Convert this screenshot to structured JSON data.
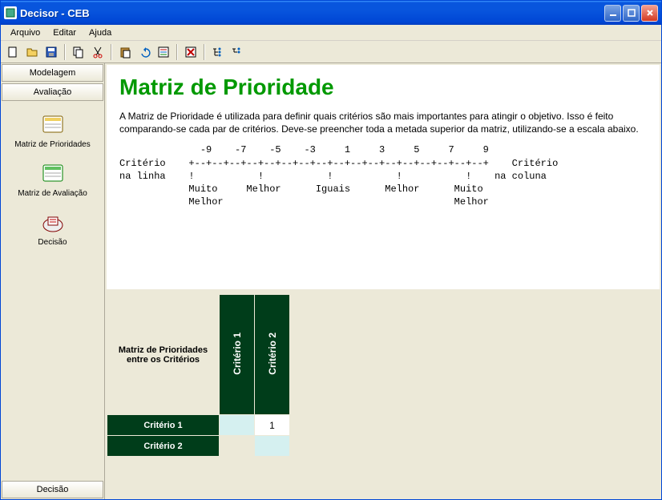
{
  "window": {
    "title": "Decisor - CEB"
  },
  "menu": {
    "items": [
      "Arquivo",
      "Editar",
      "Ajuda"
    ]
  },
  "toolbar": {
    "icons": [
      "new-icon",
      "open-icon",
      "save-icon",
      "copy-icon",
      "cut-icon",
      "paste-icon",
      "undo-icon",
      "props-icon",
      "delete-icon",
      "expand-icon",
      "collapse-icon"
    ]
  },
  "sidebar": {
    "tabs": [
      "Modelagem",
      "Avaliação"
    ],
    "items": [
      {
        "label": "Matriz de Prioridades",
        "icon": "matrix-priorities-icon"
      },
      {
        "label": "Matriz de Avaliação",
        "icon": "matrix-evaluation-icon"
      },
      {
        "label": "Decisão",
        "icon": "decision-icon"
      }
    ],
    "bottom_tab": "Decisão"
  },
  "page": {
    "title": "Matriz de Prioridade",
    "intro": "A Matriz de Prioridade é utilizada para definir quais critérios são mais importantes para atingir o objetivo. Isso é feito comparando-se cada par de critérios. Deve-se preencher toda a metada superior da matriz, utilizando-se a escala abaixo.",
    "scale_lines": [
      "              -9    -7    -5    -3     1     3     5     7     9",
      "Critério    +--+--+--+--+--+--+--+--+--+--+--+--+--+--+--+--+--+    Critério",
      "na linha    !           !           !           !           !    na coluna",
      "            Muito     Melhor      Iguais      Melhor      Muito",
      "            Melhor                                        Melhor"
    ]
  },
  "matrix": {
    "corner": "Matriz de Prioridades entre os Critérios",
    "cols": [
      "Critério 1",
      "Critério 2"
    ],
    "rows": [
      "Critério 1",
      "Critério 2"
    ],
    "cells": {
      "r0c1": "1"
    }
  }
}
